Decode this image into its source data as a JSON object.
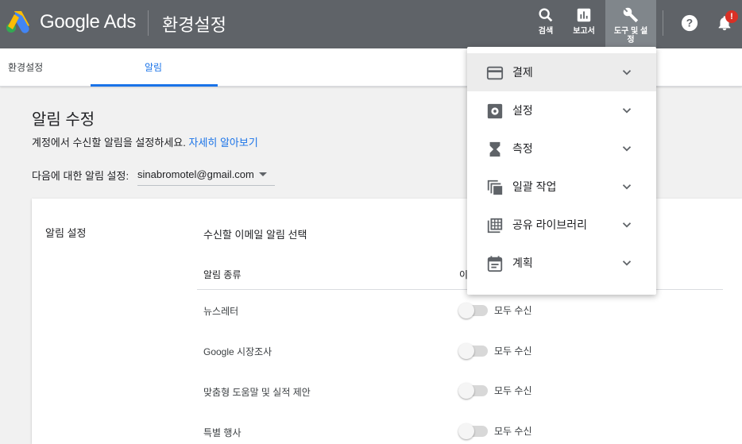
{
  "header": {
    "brand": "Google Ads",
    "page_title": "환경설정",
    "search_label": "검색",
    "reports_label": "보고서",
    "tools_label_line1": "도구 및 설",
    "tools_label_line2": "정",
    "notifications_badge": "!",
    "colors": {
      "bar": "#5f6368",
      "active": "#80868b",
      "badge": "#d93025"
    }
  },
  "subnav": {
    "tabs": [
      {
        "label": "환경설정",
        "active": false
      },
      {
        "label": "알림",
        "active": true
      }
    ],
    "accent": "#1a73e8"
  },
  "main": {
    "title": "알림 수정",
    "description": "계정에서 수신할 알림을 설정하세요.",
    "learn_more": "자세히 알아보기",
    "account_label": "다음에 대한 알림 설정:",
    "account_value": "sinabromotel@gmail.com"
  },
  "card": {
    "section_label": "알림 설정",
    "section_title": "수신할 이메일 알림 선택",
    "col_type": "알림 종류",
    "col_email": "이",
    "rows": [
      {
        "label": "뉴스레터",
        "toggle": "모두 수신",
        "enabled": false
      },
      {
        "label": "Google 시장조사",
        "toggle": "모두 수신",
        "enabled": false
      },
      {
        "label": "맞춤형 도움말 및 실적 제안",
        "toggle": "모두 수신",
        "enabled": false
      },
      {
        "label": "특별 행사",
        "toggle": "모두 수신",
        "enabled": false
      }
    ]
  },
  "menu": {
    "items": [
      {
        "label": "결제",
        "icon": "credit-card-icon",
        "active": true
      },
      {
        "label": "설정",
        "icon": "settings-icon",
        "active": false
      },
      {
        "label": "측정",
        "icon": "hourglass-icon",
        "active": false
      },
      {
        "label": "일괄 작업",
        "icon": "copy-stack-icon",
        "active": false
      },
      {
        "label": "공유 라이브러리",
        "icon": "library-icon",
        "active": false
      },
      {
        "label": "계획",
        "icon": "calendar-icon",
        "active": false
      }
    ]
  }
}
